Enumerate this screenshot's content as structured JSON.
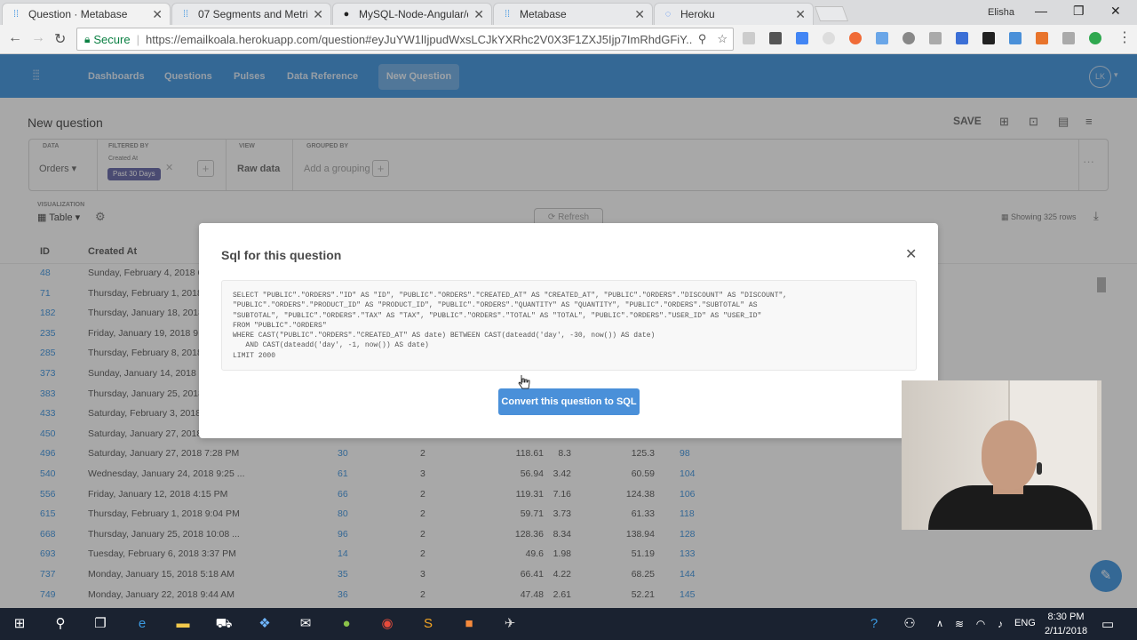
{
  "browser": {
    "tabs": [
      {
        "title": "Question · Metabase",
        "icon": "metabase-icon",
        "active": true
      },
      {
        "title": "07 Segments and Metric",
        "icon": "metabase-icon",
        "active": false
      },
      {
        "title": "MySQL-Node-Angular/d",
        "icon": "github-icon",
        "active": false
      },
      {
        "title": "Metabase",
        "icon": "metabase-icon",
        "active": false
      },
      {
        "title": "Heroku",
        "icon": "loading-icon",
        "active": false
      }
    ],
    "user": "Elisha",
    "secure_label": "Secure",
    "url": "https://emailkoala.herokuapp.com/question#eyJuYW1lIjpudWxsLCJkYXRhc2V0X3F1ZXJ5Ijp7ImRhdGFiY..."
  },
  "metabase": {
    "nav": [
      "Dashboards",
      "Questions",
      "Pulses",
      "Data Reference"
    ],
    "new_question": "New Question",
    "avatar": "LK",
    "title": "New question",
    "save": "SAVE",
    "query": {
      "data_label": "DATA",
      "data_value": "Orders",
      "filtered_label": "FILTERED BY",
      "filter_field": "Created At",
      "filter_value": "Past 30 Days",
      "view_label": "VIEW",
      "view_value": "Raw data",
      "grouped_label": "GROUPED BY",
      "grouped_value": "Add a grouping"
    },
    "viz_label": "VISUALIZATION",
    "viz_value": "Table",
    "refresh": "Refresh",
    "showing": "Showing 325 rows",
    "columns": [
      "ID",
      "Created At"
    ],
    "rows": [
      {
        "id": "48",
        "date": "Sunday, February 4, 2018 6:",
        "user": "",
        "qty": "",
        "sub": "",
        "tax": "",
        "tot": "",
        "prod": ""
      },
      {
        "id": "71",
        "date": "Thursday, February 1, 2018 6",
        "user": "",
        "qty": "",
        "sub": "",
        "tax": "",
        "tot": "",
        "prod": ""
      },
      {
        "id": "182",
        "date": "Thursday, January 18, 2018",
        "user": "",
        "qty": "",
        "sub": "",
        "tax": "",
        "tot": "",
        "prod": ""
      },
      {
        "id": "235",
        "date": "Friday, January 19, 2018 9:2",
        "user": "",
        "qty": "",
        "sub": "",
        "tax": "",
        "tot": "",
        "prod": ""
      },
      {
        "id": "285",
        "date": "Thursday, February 8, 2018",
        "user": "",
        "qty": "",
        "sub": "",
        "tax": "",
        "tot": "",
        "prod": ""
      },
      {
        "id": "373",
        "date": "Sunday, January 14, 2018 6:",
        "user": "",
        "qty": "",
        "sub": "",
        "tax": "",
        "tot": "",
        "prod": ""
      },
      {
        "id": "383",
        "date": "Thursday, January 25, 2018",
        "user": "",
        "qty": "",
        "sub": "",
        "tax": "",
        "tot": "",
        "prod": ""
      },
      {
        "id": "433",
        "date": "Saturday, February 3, 2018",
        "user": "",
        "qty": "",
        "sub": "",
        "tax": "",
        "tot": "",
        "prod": ""
      },
      {
        "id": "450",
        "date": "Saturday, January 27, 2018",
        "user": "",
        "qty": "",
        "sub": "",
        "tax": "",
        "tot": "",
        "prod": ""
      },
      {
        "id": "496",
        "date": "Saturday, January 27, 2018 7:28 PM",
        "user": "30",
        "qty": "2",
        "sub": "118.61",
        "tax": "8.3",
        "tot": "125.3",
        "prod": "98"
      },
      {
        "id": "540",
        "date": "Wednesday, January 24, 2018 9:25 ...",
        "user": "61",
        "qty": "3",
        "sub": "56.94",
        "tax": "3.42",
        "tot": "60.59",
        "prod": "104"
      },
      {
        "id": "556",
        "date": "Friday, January 12, 2018 4:15 PM",
        "user": "66",
        "qty": "2",
        "sub": "119.31",
        "tax": "7.16",
        "tot": "124.38",
        "prod": "106"
      },
      {
        "id": "615",
        "date": "Thursday, February 1, 2018 9:04 PM",
        "user": "80",
        "qty": "2",
        "sub": "59.71",
        "tax": "3.73",
        "tot": "61.33",
        "prod": "118"
      },
      {
        "id": "668",
        "date": "Thursday, January 25, 2018 10:08 ...",
        "user": "96",
        "qty": "2",
        "sub": "128.36",
        "tax": "8.34",
        "tot": "138.94",
        "prod": "128"
      },
      {
        "id": "693",
        "date": "Tuesday, February 6, 2018 3:37 PM",
        "user": "14",
        "qty": "2",
        "sub": "49.6",
        "tax": "1.98",
        "tot": "51.19",
        "prod": "133"
      },
      {
        "id": "737",
        "date": "Monday, January 15, 2018 5:18 AM",
        "user": "35",
        "qty": "3",
        "sub": "66.41",
        "tax": "4.22",
        "tot": "68.25",
        "prod": "144"
      },
      {
        "id": "749",
        "date": "Monday, January 22, 2018 9:44 AM",
        "user": "36",
        "qty": "2",
        "sub": "47.48",
        "tax": "2.61",
        "tot": "52.21",
        "prod": "145"
      }
    ]
  },
  "modal": {
    "title": "Sql for this question",
    "sql": "SELECT \"PUBLIC\".\"ORDERS\".\"ID\" AS \"ID\", \"PUBLIC\".\"ORDERS\".\"CREATED_AT\" AS \"CREATED_AT\", \"PUBLIC\".\"ORDERS\".\"DISCOUNT\" AS \"DISCOUNT\",\n\"PUBLIC\".\"ORDERS\".\"PRODUCT_ID\" AS \"PRODUCT_ID\", \"PUBLIC\".\"ORDERS\".\"QUANTITY\" AS \"QUANTITY\", \"PUBLIC\".\"ORDERS\".\"SUBTOTAL\" AS\n\"SUBTOTAL\", \"PUBLIC\".\"ORDERS\".\"TAX\" AS \"TAX\", \"PUBLIC\".\"ORDERS\".\"TOTAL\" AS \"TOTAL\", \"PUBLIC\".\"ORDERS\".\"USER_ID\" AS \"USER_ID\"\nFROM \"PUBLIC\".\"ORDERS\"\nWHERE CAST(\"PUBLIC\".\"ORDERS\".\"CREATED_AT\" AS date) BETWEEN CAST(dateadd('day', -30, now()) AS date)\n   AND CAST(dateadd('day', -1, now()) AS date)\nLIMIT 2000",
    "convert_button": "Convert this question to SQL"
  },
  "taskbar": {
    "lang": "ENG",
    "time": "8:30 PM",
    "date": "2/11/2018"
  },
  "colors": {
    "brand": "#509ee3",
    "filter_pill": "#7172ad",
    "taskbar": "#1a2230"
  }
}
